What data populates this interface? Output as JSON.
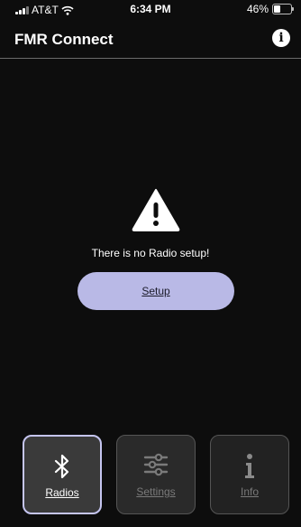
{
  "status_bar": {
    "carrier": "AT&T",
    "time": "6:34 PM",
    "battery": "46%",
    "battery_level": 0.46
  },
  "header": {
    "title": "FMR Connect",
    "info_icon": "info-circle-icon"
  },
  "main": {
    "warning_icon": "warning-triangle-icon",
    "message": "There is no Radio setup!",
    "setup_button": "Setup"
  },
  "tabs": [
    {
      "label": "Radios",
      "icon": "bluetooth-icon",
      "active": true
    },
    {
      "label": "Settings",
      "icon": "sliders-icon",
      "active": false
    },
    {
      "label": "Info",
      "icon": "info-icon",
      "active": false
    }
  ],
  "colors": {
    "accent": "#b9b9e6",
    "background": "#0d0d0d",
    "active_tab_border": "#c5c5f0"
  }
}
